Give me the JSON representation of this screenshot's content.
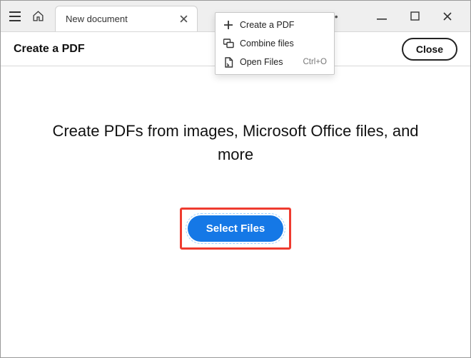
{
  "tab": {
    "title": "New document"
  },
  "page": {
    "title": "Create a PDF",
    "close_label": "Close",
    "headline": "Create PDFs from images, Microsoft Office files, and more",
    "select_files_label": "Select Files"
  },
  "menu": {
    "items": [
      {
        "label": "Create a PDF",
        "icon": "plus-icon",
        "shortcut": ""
      },
      {
        "label": "Combine files",
        "icon": "combine-icon",
        "shortcut": ""
      },
      {
        "label": "Open Files",
        "icon": "open-file-icon",
        "shortcut": "Ctrl+O"
      }
    ]
  }
}
